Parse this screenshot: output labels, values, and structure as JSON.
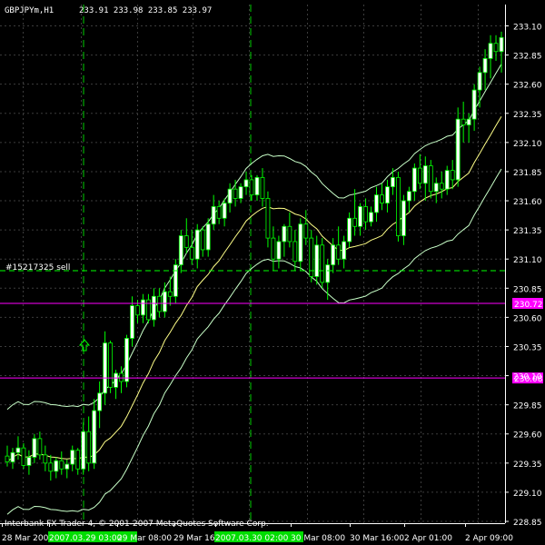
{
  "header": {
    "symbol_tf": "GBPJPYm,H1",
    "ohlc": "233.91 233.98 233.85 233.97"
  },
  "footer": {
    "copyright": "Interbank FX Trader 4, © 2001-2007 MetaQuotes Software Corp."
  },
  "order_label": "#15217325 sell",
  "colors": {
    "background": "#000000",
    "grid": "#3c3c3c",
    "bull_candle": "#ffffff",
    "bear_candle": "#000000",
    "wick": "#00ff00",
    "ma": "#ffff88",
    "envelope": "#c8ffc8",
    "vline": "#00cc00",
    "order_line": "#00ff00",
    "level_line": "#ff00ff",
    "time_highlight": "#00dd00",
    "text": "#ffffff"
  },
  "chart_data": {
    "type": "candlestick",
    "title": "GBPJPYm,H1",
    "ylim": [
      228.85,
      233.1
    ],
    "price_ticks": [
      "233.10",
      "232.85",
      "232.60",
      "232.35",
      "232.10",
      "231.85",
      "231.60",
      "231.35",
      "231.10",
      "230.85",
      "230.60",
      "230.35",
      "230.10",
      "229.85",
      "229.60",
      "229.35",
      "229.10",
      "228.85"
    ],
    "time_labels": [
      "28 Mar 2007",
      "2007.03.29 03:00",
      "29 Mar 08:00",
      "29 Mar 16",
      "2007.03.30 02:00",
      "30 Mar 08:00",
      "30 Mar 16:00",
      "2 Apr 01:00",
      "2 Apr 09:00"
    ],
    "highlighted_times": [
      "2007.03.29 03:00",
      "2007.03.30 02:00"
    ],
    "level_lines": [
      {
        "price": 230.72,
        "label": "230.72"
      },
      {
        "price": 230.08,
        "label": "230.08"
      }
    ],
    "order_line_price": 231.0,
    "candles": [
      [
        229.41,
        229.5,
        229.32,
        229.36
      ],
      [
        229.36,
        229.48,
        229.3,
        229.44
      ],
      [
        229.44,
        229.58,
        229.38,
        229.48
      ],
      [
        229.48,
        229.52,
        229.3,
        229.33
      ],
      [
        229.33,
        229.46,
        229.25,
        229.4
      ],
      [
        229.4,
        229.6,
        229.35,
        229.56
      ],
      [
        229.56,
        229.62,
        229.38,
        229.42
      ],
      [
        229.42,
        229.5,
        229.28,
        229.35
      ],
      [
        229.35,
        229.42,
        229.2,
        229.28
      ],
      [
        229.28,
        229.4,
        229.22,
        229.37
      ],
      [
        229.37,
        229.45,
        229.25,
        229.3
      ],
      [
        229.3,
        229.38,
        229.22,
        229.34
      ],
      [
        229.34,
        229.5,
        229.28,
        229.46
      ],
      [
        229.46,
        229.48,
        229.25,
        229.3
      ],
      [
        229.3,
        229.7,
        229.25,
        229.62
      ],
      [
        229.62,
        229.75,
        229.28,
        229.35
      ],
      [
        229.35,
        229.9,
        229.3,
        229.8
      ],
      [
        229.8,
        230.05,
        229.65,
        229.95
      ],
      [
        229.95,
        230.48,
        229.85,
        230.38
      ],
      [
        230.38,
        230.4,
        229.95,
        230.0
      ],
      [
        230.0,
        230.15,
        229.9,
        230.12
      ],
      [
        230.12,
        230.18,
        229.95,
        230.05
      ],
      [
        230.05,
        230.45,
        230.0,
        230.42
      ],
      [
        230.42,
        230.78,
        230.35,
        230.7
      ],
      [
        230.7,
        230.75,
        230.55,
        230.62
      ],
      [
        230.62,
        230.8,
        230.55,
        230.75
      ],
      [
        230.75,
        230.8,
        230.55,
        230.58
      ],
      [
        230.58,
        230.85,
        230.52,
        230.78
      ],
      [
        230.78,
        230.85,
        230.6,
        230.65
      ],
      [
        230.65,
        230.9,
        230.6,
        230.82
      ],
      [
        230.82,
        230.95,
        230.7,
        230.78
      ],
      [
        230.78,
        231.1,
        230.72,
        231.05
      ],
      [
        231.05,
        231.35,
        230.98,
        231.3
      ],
      [
        231.3,
        231.45,
        231.15,
        231.2
      ],
      [
        231.2,
        231.35,
        231.05,
        231.1
      ],
      [
        231.1,
        231.4,
        231.02,
        231.35
      ],
      [
        231.35,
        231.38,
        231.12,
        231.18
      ],
      [
        231.18,
        231.45,
        231.12,
        231.4
      ],
      [
        231.4,
        231.65,
        231.35,
        231.55
      ],
      [
        231.55,
        231.6,
        231.4,
        231.45
      ],
      [
        231.45,
        231.62,
        231.38,
        231.58
      ],
      [
        231.58,
        231.75,
        231.5,
        231.7
      ],
      [
        231.7,
        231.78,
        231.55,
        231.62
      ],
      [
        231.62,
        231.75,
        231.58,
        231.72
      ],
      [
        231.72,
        231.85,
        231.65,
        231.78
      ],
      [
        231.78,
        231.82,
        231.6,
        231.65
      ],
      [
        231.65,
        231.82,
        231.6,
        231.8
      ],
      [
        231.8,
        231.88,
        231.55,
        231.62
      ],
      [
        231.62,
        231.68,
        231.2,
        231.28
      ],
      [
        231.28,
        231.38,
        231.0,
        231.1
      ],
      [
        231.1,
        231.3,
        231.02,
        231.25
      ],
      [
        231.25,
        231.4,
        231.12,
        231.38
      ],
      [
        231.38,
        231.5,
        231.2,
        231.25
      ],
      [
        231.25,
        231.35,
        231.0,
        231.08
      ],
      [
        231.08,
        231.45,
        231.0,
        231.4
      ],
      [
        231.4,
        231.52,
        231.22,
        231.28
      ],
      [
        231.28,
        231.35,
        230.9,
        230.95
      ],
      [
        230.95,
        231.3,
        230.88,
        231.22
      ],
      [
        231.22,
        231.28,
        230.85,
        230.9
      ],
      [
        230.9,
        231.1,
        230.75,
        231.05
      ],
      [
        231.05,
        231.28,
        230.98,
        231.22
      ],
      [
        231.22,
        231.38,
        231.05,
        231.1
      ],
      [
        231.1,
        231.3,
        231.02,
        231.25
      ],
      [
        231.25,
        231.5,
        231.2,
        231.45
      ],
      [
        231.45,
        231.7,
        231.3,
        231.38
      ],
      [
        231.38,
        231.58,
        231.3,
        231.55
      ],
      [
        231.55,
        231.62,
        231.35,
        231.42
      ],
      [
        231.42,
        231.55,
        231.38,
        231.5
      ],
      [
        231.5,
        231.72,
        231.42,
        231.65
      ],
      [
        231.65,
        231.75,
        231.52,
        231.58
      ],
      [
        231.58,
        231.78,
        231.5,
        231.72
      ],
      [
        231.72,
        231.88,
        231.65,
        231.8
      ],
      [
        231.8,
        231.85,
        231.25,
        231.3
      ],
      [
        231.3,
        231.65,
        231.22,
        231.6
      ],
      [
        231.6,
        231.72,
        231.5,
        231.68
      ],
      [
        231.68,
        231.92,
        231.6,
        231.88
      ],
      [
        231.88,
        232.0,
        231.7,
        231.75
      ],
      [
        231.75,
        231.98,
        231.6,
        231.9
      ],
      [
        231.9,
        231.95,
        231.62,
        231.68
      ],
      [
        231.68,
        231.8,
        231.58,
        231.75
      ],
      [
        231.75,
        231.85,
        231.62,
        231.7
      ],
      [
        231.7,
        231.9,
        231.65,
        231.86
      ],
      [
        231.86,
        231.95,
        231.7,
        231.78
      ],
      [
        231.78,
        232.4,
        231.72,
        232.3
      ],
      [
        232.3,
        232.45,
        232.1,
        232.25
      ],
      [
        232.25,
        232.35,
        232.1,
        232.3
      ],
      [
        232.3,
        232.6,
        232.2,
        232.55
      ],
      [
        232.55,
        232.75,
        232.4,
        232.7
      ],
      [
        232.7,
        232.9,
        232.55,
        232.82
      ],
      [
        232.82,
        233.02,
        232.65,
        232.95
      ],
      [
        232.95,
        233.02,
        232.8,
        232.88
      ],
      [
        232.88,
        233.05,
        232.7,
        233.0
      ]
    ]
  }
}
